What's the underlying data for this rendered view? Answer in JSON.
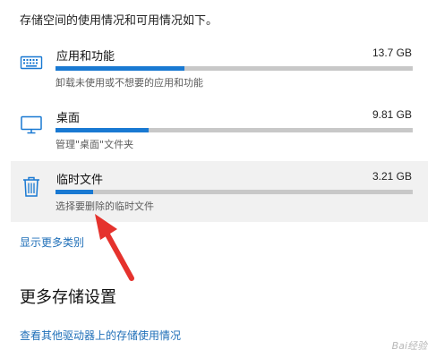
{
  "intro": "存储空间的使用情况和可用情况如下。",
  "colors": {
    "accent": "#1979d2",
    "track": "#c8c8c8",
    "link": "#1f6fb8",
    "arrow": "#e5322d"
  },
  "storage_items": [
    {
      "icon": "keyboard-icon",
      "name": "应用和功能",
      "size": "13.7 GB",
      "usage_fraction": 0.36,
      "description": "卸载未使用或不想要的应用和功能"
    },
    {
      "icon": "monitor-icon",
      "name": "桌面",
      "size": "9.81 GB",
      "usage_fraction": 0.26,
      "description": "管理\"桌面\"文件夹"
    },
    {
      "icon": "trash-icon",
      "name": "临时文件",
      "size": "3.21 GB",
      "usage_fraction": 0.105,
      "description": "选择要删除的临时文件"
    }
  ],
  "show_more_link": "显示更多类别",
  "more_settings": {
    "heading": "更多存储设置",
    "link": "查看其他驱动器上的存储使用情况"
  },
  "watermark": "Bai经验"
}
